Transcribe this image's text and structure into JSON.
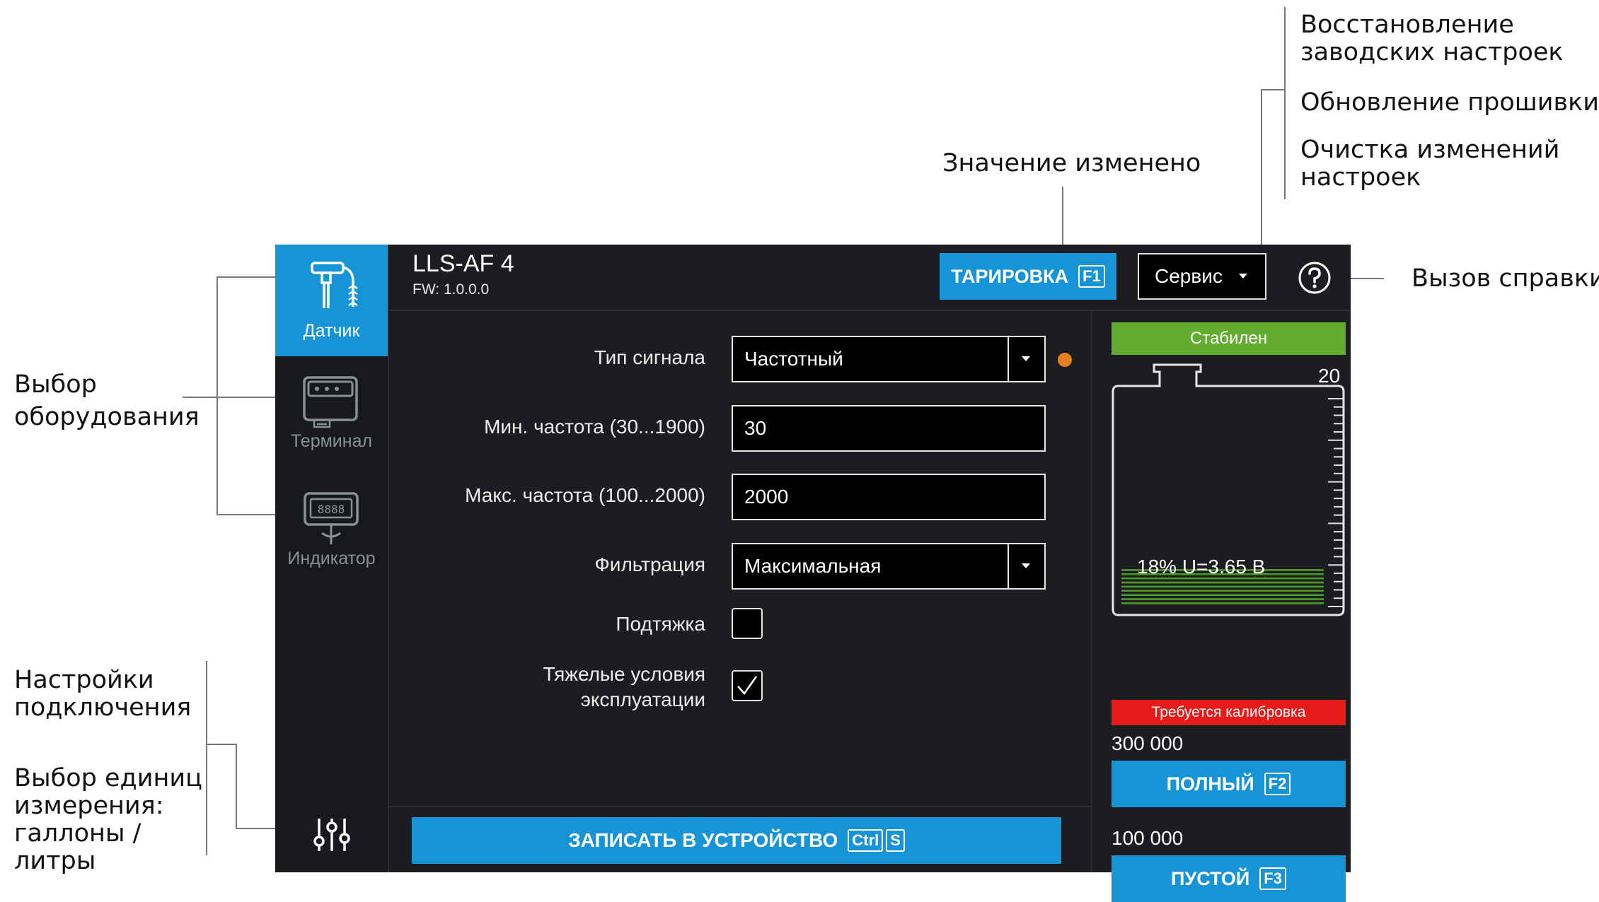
{
  "annotations": {
    "restore_factory": [
      "Восстановление",
      "заводских настроек"
    ],
    "firmware_update": "Обновление прошивки",
    "clear_changes": [
      "Очистка изменений",
      "настроек"
    ],
    "value_changed": "Значение изменено",
    "help_call": "Вызов справки",
    "equipment_select": [
      "Выбор",
      "оборудования"
    ],
    "connection_settings": [
      "Настройки",
      "подключения"
    ],
    "units_select": [
      "Выбор единиц",
      "измерения:",
      "галлоны /",
      "литры"
    ]
  },
  "sidebar": {
    "items": [
      {
        "label": "Датчик",
        "icon": "sensor-icon",
        "active": true
      },
      {
        "label": "Терминал",
        "icon": "terminal-icon",
        "active": false
      },
      {
        "label": "Индикатор",
        "icon": "indicator-icon",
        "active": false
      }
    ],
    "settings_icon": "sliders-icon"
  },
  "header": {
    "title": "LLS-AF 4",
    "fw": "FW:  1.0.0.0",
    "tare_label": "ТАРИРОВКА",
    "tare_key": "F1",
    "service_label": "Сервис",
    "help_icon": "question-circle-icon"
  },
  "form": {
    "signal_type_label": "Тип сигнала",
    "signal_type_value": "Частотный",
    "min_freq_label": "Мин. частота (30...1900)",
    "min_freq_value": "30",
    "max_freq_label": "Макс. частота (100...2000)",
    "max_freq_value": "2000",
    "filter_label": "Фильтрация",
    "filter_value": "Максимальная",
    "pullup_label": "Подтяжка",
    "pullup_checked": false,
    "harsh_label_1": "Тяжелые условия",
    "harsh_label_2": "эксплуатации",
    "harsh_checked": true,
    "changed_indicator_color": "#e67e22"
  },
  "write_button": {
    "label": "ЗАПИСАТЬ В УСТРОЙСТВО",
    "key1": "Ctrl",
    "key2": "S"
  },
  "right": {
    "status": "Стабилен",
    "status_color": "#62ad2f",
    "tank_max": "20",
    "tank_reading": "18% U=3.65 В",
    "level_fraction": 0.18,
    "calib_warning": "Требуется калибровка",
    "calib_color": "#e81b1b",
    "full_value": "300 000",
    "full_label": "ПОЛНЫЙ",
    "full_key": "F2",
    "empty_value": "100 000",
    "empty_label": "ПУСТОЙ",
    "empty_key": "F3"
  },
  "colors": {
    "accent": "#1794d6",
    "background": "#1b1d21"
  }
}
